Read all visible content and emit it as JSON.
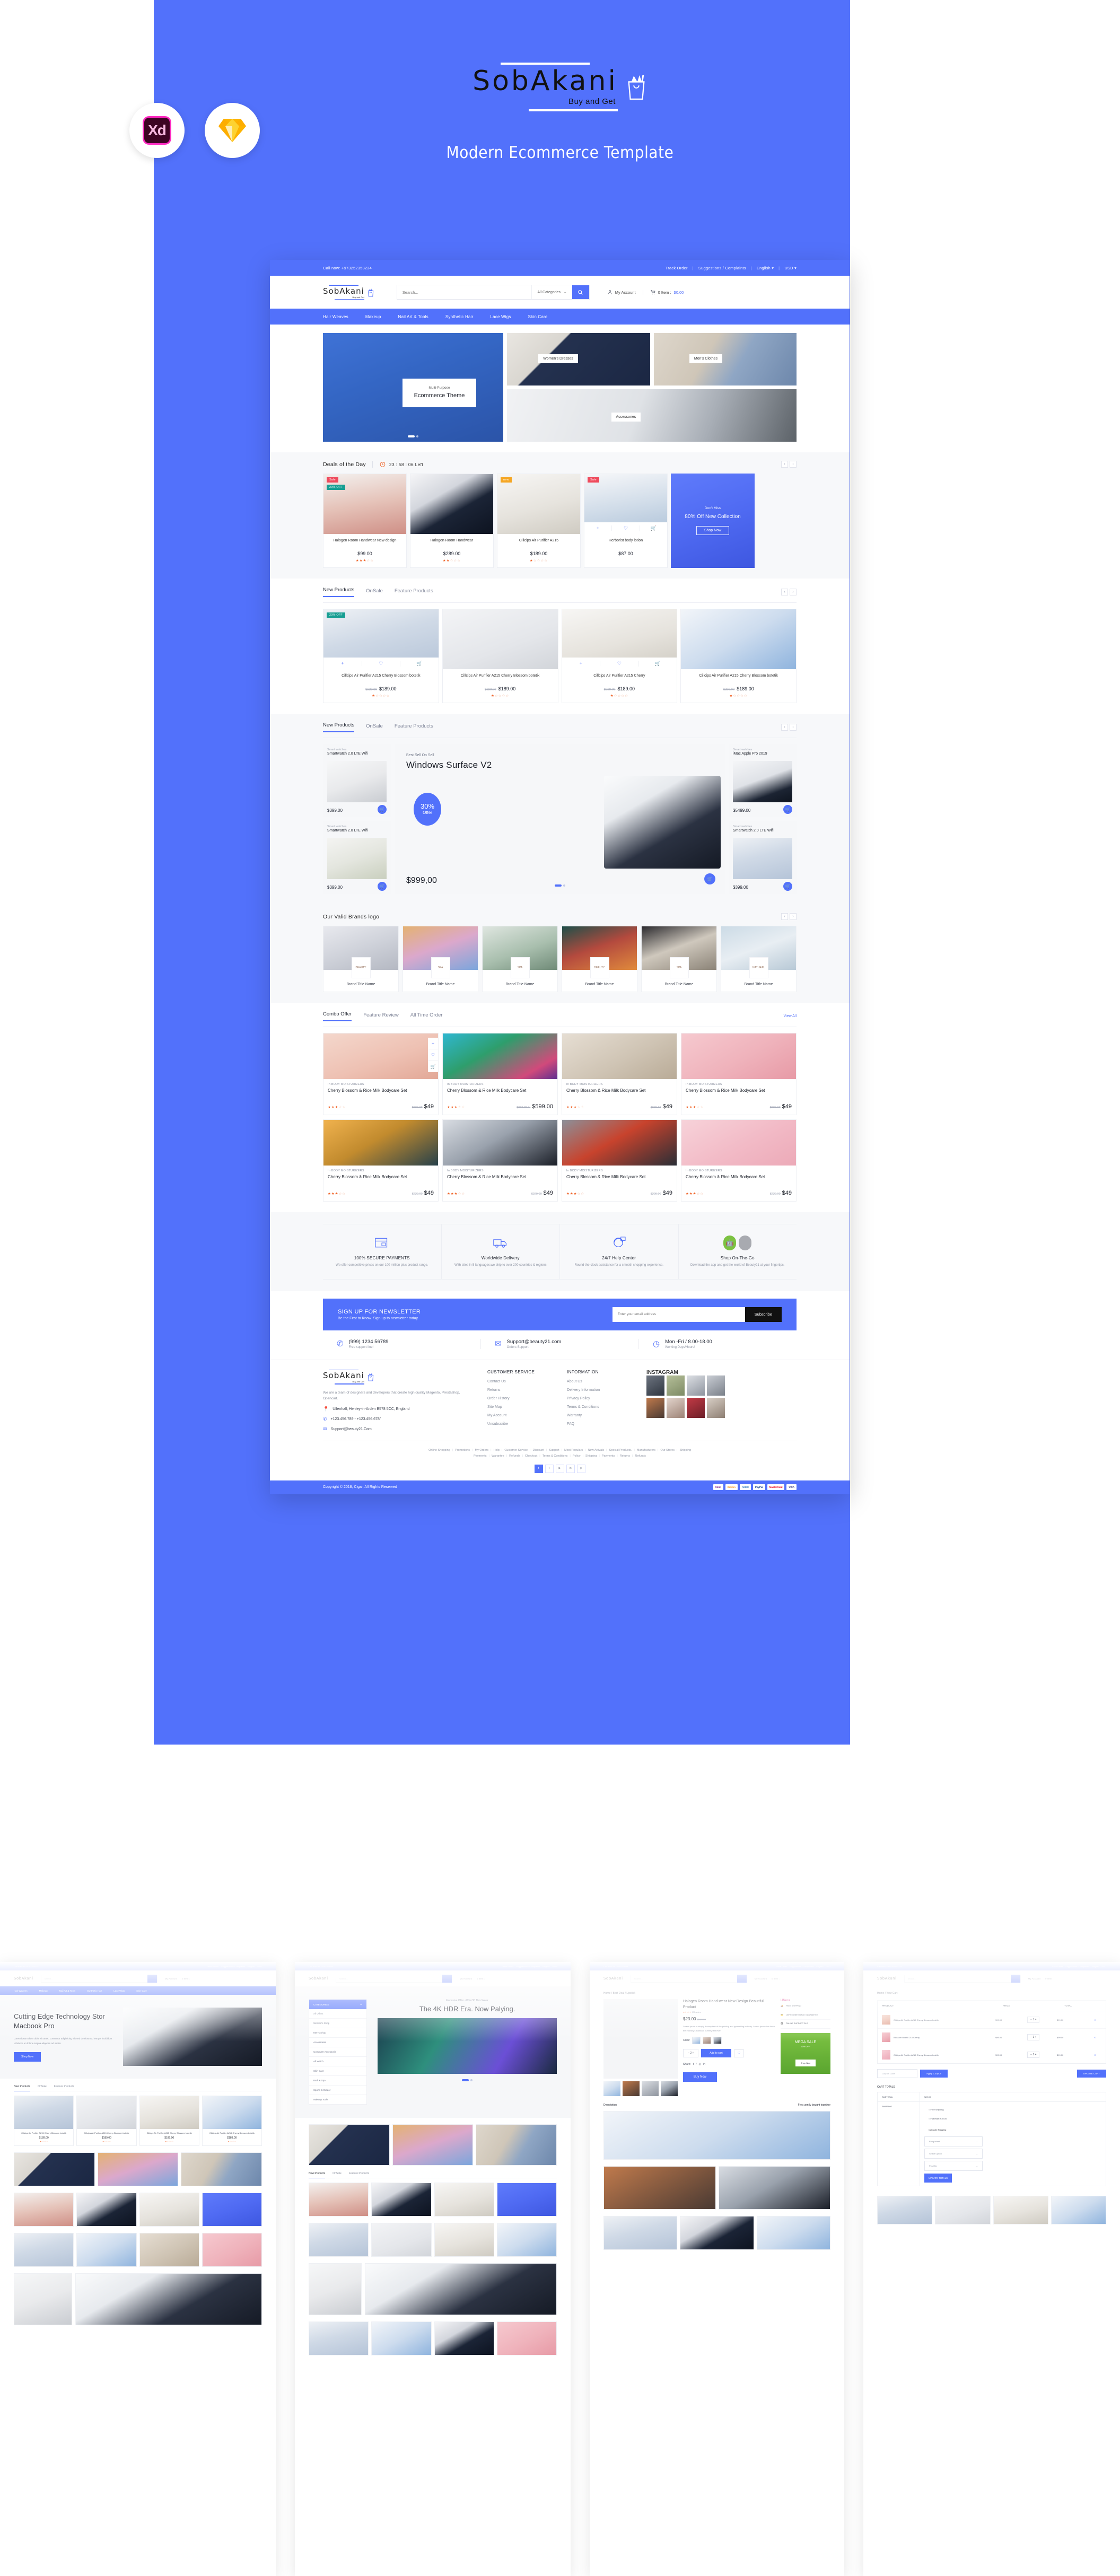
{
  "hero": {
    "tagline": "Modern Ecommerce Template",
    "logo": {
      "name": "SobAkani",
      "tagline": "Buy and Get"
    },
    "badges": [
      {
        "name": "Adobe Xd",
        "label": "Xd"
      },
      {
        "name": "Sketch",
        "label": ""
      }
    ],
    "accent": "#5271fb"
  },
  "site": {
    "topbar": {
      "call": "Call now: +973252353234",
      "track_order": "Track Order",
      "suggestions": "Suggestions / Complaints",
      "language": "English",
      "currency": "USD"
    },
    "masthead": {
      "logo_name": "SobAkani",
      "logo_tagline": "Buy and Get",
      "search_placeholder": "Search...",
      "search_value": "",
      "categories_label": "All Categories",
      "account_label": "My Account",
      "cart_label": "0 Item :",
      "cart_amount": "$0.00"
    },
    "nav": [
      "Hair Weaves",
      "Makeup",
      "Nail Art & Tools",
      "Synthetic Hair",
      "Lace Wigs",
      "Skin Care"
    ],
    "hero_banners": {
      "main_kicker": "Multi-Purpose",
      "main_title": "Ecommerce Theme",
      "cells": [
        "Women's Dresses",
        "Men's Clothes",
        "Accessories"
      ]
    },
    "deals": {
      "title": "Deals of the Day",
      "timer": "23 : 58 : 06 Left",
      "products": [
        {
          "name": "Halogen Room Handwear New design",
          "price": "$99.00",
          "badge": "Sale",
          "badge2": "20% OFF",
          "stars": 3
        },
        {
          "name": "Halogen Room Handwear",
          "price": "$289.00",
          "badge": "",
          "badge2": "",
          "stars": 2
        },
        {
          "name": "Cillcips Air Purifier A215",
          "price": "$189.00",
          "badge": "new",
          "badge2": "",
          "stars": 1
        },
        {
          "name": "Herborist body lotion",
          "price": "$87.00",
          "badge": "Sale",
          "badge2": "",
          "stars": 0
        }
      ],
      "promo": {
        "kicker": "Don't Miss",
        "title": "80% Off New Collection",
        "button": "Shop Now"
      }
    },
    "new_products": {
      "tabs": [
        "New Products",
        "OnSale",
        "Feature Products"
      ],
      "active_tab": "New Products",
      "products": [
        {
          "name": "Cillcips Air Purifier A215 Cherry Blossom botetik",
          "old": "$229.00",
          "price": "$189.00",
          "badge": "20% OFF",
          "stars": 1
        },
        {
          "name": "Cillcips Air Purifier A215 Cherry Blossom botetik",
          "old": "$229.00",
          "price": "$189.00",
          "badge": "",
          "stars": 1
        },
        {
          "name": "Cillcips Air Purifier A215 Cherry",
          "old": "$229.00",
          "price": "$189.00",
          "badge": "",
          "stars": 1
        },
        {
          "name": "Cillcips Air Purifier A215 Cherry Blossom botetik",
          "old": "$229.00",
          "price": "$189.00",
          "badge": "",
          "stars": 1
        }
      ]
    },
    "featured": {
      "tabs": [
        "New Products",
        "OnSale",
        "Feature Products"
      ],
      "active_tab": "New Products",
      "main": {
        "kicker": "Best Sell On Sell",
        "title": "Windows Surface V2",
        "offer_pct": "30%",
        "offer_word": "Offer",
        "price": "$999,00"
      },
      "minis": [
        {
          "cat": "Smart watches",
          "name": "Smartwatch 2.0 LTE Wifi",
          "price": "$399.00"
        },
        {
          "cat": "Smart watches",
          "name": "Smartwatch 2.0 LTE Wifi",
          "price": "$399.00"
        },
        {
          "cat": "Smart watches",
          "name": "iMac Apple Pro 2019",
          "price": "$5499.00"
        },
        {
          "cat": "Smart watches",
          "name": "Smartwatch 2.0 LTE Wifi",
          "price": "$399.00"
        }
      ]
    },
    "brands": {
      "title": "Our Valid Brands logo",
      "items": [
        {
          "name": "Brand Title Name",
          "logo": "BEAUTY"
        },
        {
          "name": "Brand Title Name",
          "logo": "SPA"
        },
        {
          "name": "Brand Title Name",
          "logo": "SPA"
        },
        {
          "name": "Brand Title Name",
          "logo": "BEAUTY"
        },
        {
          "name": "Brand Title Name",
          "logo": "SPA"
        },
        {
          "name": "Brand Title Name",
          "logo": "NATURAL"
        }
      ]
    },
    "combo": {
      "tabs": [
        "Combo Offer",
        "Feature Review",
        "All Time Order"
      ],
      "active_tab": "Combo Offer",
      "view_all": "View All",
      "row1": [
        {
          "cat": "In BODY MOISTURIZERS",
          "name": "Cherry Blossom & Rice Milk Bodycare Set",
          "old": "$229.00",
          "price": "$49",
          "stars": 3
        },
        {
          "cat": "In BODY MOISTURIZERS",
          "name": "Cherry Blossom & Rice Milk Bodycare Set",
          "old": "$999.00 to",
          "price": "$599.00",
          "stars": 3
        },
        {
          "cat": "In BODY MOISTURIZERS",
          "name": "Cherry Blossom & Rice Milk Bodycare Set",
          "old": "$229.00",
          "price": "$49",
          "stars": 3
        },
        {
          "cat": "In BODY MOISTURIZERS",
          "name": "Cherry Blossom & Rice Milk Bodycare Set",
          "old": "$229.00",
          "price": "$49",
          "stars": 3
        }
      ],
      "row2": [
        {
          "cat": "In BODY MOISTURIZERS",
          "name": "Cherry Blossom & Rice Milk Bodycare Set",
          "old": "$229.00",
          "price": "$49",
          "stars": 3
        },
        {
          "cat": "In BODY MOISTURIZERS",
          "name": "Cherry Blossom & Rice Milk Bodycare Set",
          "old": "$229.00",
          "price": "$49",
          "stars": 3
        },
        {
          "cat": "In BODY MOISTURIZERS",
          "name": "Cherry Blossom & Rice Milk Bodycare Set",
          "old": "$229.00",
          "price": "$49",
          "stars": 3
        },
        {
          "cat": "In BODY MOISTURIZERS",
          "name": "Cherry Blossom & Rice Milk Bodycare Set",
          "old": "$229.00",
          "price": "$49",
          "stars": 3
        }
      ]
    },
    "services": [
      {
        "icon": "credit-card-icon",
        "title": "100% SECURE PAYMENTS",
        "desc": "We offer competitive prices on our 100 million plus product range."
      },
      {
        "icon": "delivery-truck-icon",
        "title": "Worldwide Delivery",
        "desc": "With sites in 5 languages,we ship to over 200 countries & regions"
      },
      {
        "icon": "headset-support-icon",
        "title": "24/7 Help Center",
        "desc": "Round-the-clock assistance for a smooth shopping experience."
      },
      {
        "icon": "app-store-icon",
        "title": "Shop On-The-Go",
        "desc": "Download the app and get the world of Beauty21 at your fingertips."
      }
    ],
    "newsletter": {
      "title": "SIGN UP FOR NEWSLETTER",
      "subtitle": "Be the First to Know. Sign up to newsletter today",
      "placeholder": "Enter your email address",
      "value": "",
      "button": "Subscribe"
    },
    "contact": [
      {
        "icon": "phone-icon",
        "big": "(999) 1234 56789",
        "small": "Free support line!"
      },
      {
        "icon": "envelope-icon",
        "big": "Support@beauty21.com",
        "small": "Orders Support!"
      },
      {
        "icon": "clock-icon",
        "big": "Mon -Fri / 8.00-18.00",
        "small": "Working Days/Hours!"
      }
    ],
    "footer": {
      "logo_name": "SobAkani",
      "logo_tagline": "Buy and Get",
      "about": "We are a team of designers and developers that create high quality Magento, Prestashop, Opencart.",
      "address": "Ullenhall, Henley-in-Arden B578 5CC, England",
      "phone": "+123.456.789 - +123.456.678/",
      "email": "Support@beauty21.Com",
      "columns": [
        {
          "title": "CUSTOMER SERVICE",
          "items": [
            "Contact Us",
            "Returns",
            "Order History",
            "Site Map",
            "My Account",
            "Unsubscribe"
          ]
        },
        {
          "title": "INFORMATION",
          "items": [
            "About Us",
            "Delivery Information",
            "Privacy Policy",
            "Terms & Conditions",
            "Warranty",
            "FAQ"
          ]
        }
      ],
      "instagram_title": "INSTAGRAM",
      "bottom_links_row1": [
        "Online Shopping",
        "Promotions",
        "My Orders",
        "Help",
        "Customer Service",
        "Discount",
        "Support",
        "Most Populars",
        "New Arrivals",
        "Special Products.",
        "Manufacturers",
        "Our Stores",
        "Shipping"
      ],
      "bottom_links_row2": [
        "Payments",
        "Warantee",
        "Refunds",
        "Checkout",
        "Terms & Conditions",
        "Policy",
        "Shipping",
        "Payments",
        "Returns",
        "Refunds"
      ],
      "socials": [
        "f",
        "t",
        "y",
        "in",
        "p"
      ],
      "copyright": "Copyright © 2018, Cigar. All Rights Reserved",
      "payments": [
        "Skrill",
        "Bitcoin",
        "AMEX",
        "PayPal",
        "MasterCard",
        "VISA"
      ]
    }
  },
  "thumbs": {
    "t1": {
      "hero_title": "Cutting Edge Technology Stor Macbook Pro",
      "hero_desc": "Lorem ipsum dolor dolor sit amet, consectur adipisicing elit sed do eiusmod tempor incididunt ut labore et dolore magna aliqenim ad minim.",
      "hero_btn": "Shop Now",
      "tabs": [
        "New Products",
        "OnSale",
        "Feature Products"
      ],
      "product_name": "Cillcips Air Purifier A215 Cherry Blossom botetik",
      "product_old": "$229.00",
      "product_price": "$189.00"
    },
    "t2": {
      "cat_title": "CATEGORIES",
      "cats": [
        "All Offers",
        "Women's Shop",
        "Men's Shop",
        "Accessories",
        "Computer Accessoris",
        "All Watch",
        "Skin Care",
        "Bath & Spa",
        "Sports & Outdor",
        "Makeup Tools"
      ],
      "banner_kicker": "Exclusive Offer -20% Off This Week",
      "banner_title": "The 4K HDR Era. Now Palying."
    },
    "t3": {
      "breadcrumb": "Home / Best Deal / Lipstick",
      "title": "Halogen Room Hand-wear New Design Beautiful Product",
      "orders": "305 orders",
      "price": "$23.00",
      "old_price": "$229.00",
      "desc": "Lorem Ipsum is simply dummy text of the printing and typesetting industry. Lorem Ipsum has been the industry's standard dummy text ever",
      "color_label": "Color:",
      "qty": "2",
      "add_cart": "Add to cart",
      "share_label": "Share:",
      "buy_now": "Buy Now",
      "brand": "UNeca",
      "features": [
        "FREE SHIPPING",
        "100% MONEY BACK GUARANTEE",
        "ONLINE SUPPORT 24/7"
      ],
      "mega_title": "MEGA SALE",
      "mega_sub": "90% OFF",
      "mega_btn": "Shop Now",
      "section_desc": "Description",
      "section_freq": "Freq uently bought together"
    },
    "t4": {
      "breadcrumb": "Home / Your Cart",
      "headers": [
        "PRODUCT",
        "PRICE",
        "TOTAL"
      ],
      "rows": [
        {
          "name": "Cillcips Air Purifier A215 Cherry Blossom botetik",
          "price": "$99.00",
          "qty": "1",
          "total": "$99.00"
        },
        {
          "name": "Blossom botetik 215 Cherry",
          "price": "$99.00",
          "qty": "1",
          "total": "$99.00"
        },
        {
          "name": "Cillcips Air Purifier A215 Cherry Blossom botetik",
          "price": "$99.00",
          "qty": "1",
          "total": "$99.00"
        }
      ],
      "coupon_placeholder": "Coupon Code",
      "apply_coupon": "Apply Coupon",
      "update_cart": "UPDATE CART",
      "totals_title": "CART TOTALS",
      "subtotal_label": "SUBTOTAL",
      "subtotal_value": "$89.00",
      "shipping_label": "SHIPPING",
      "shipping_free": "Free Shipping",
      "shipping_flat": "Flat Rate: $10.00",
      "calc_label": "Calculate Shipping",
      "country": "Bangladesh",
      "state": "Select Option",
      "postcode": "Post/Zip",
      "update_totals": "UPDATE TOTALS"
    }
  }
}
